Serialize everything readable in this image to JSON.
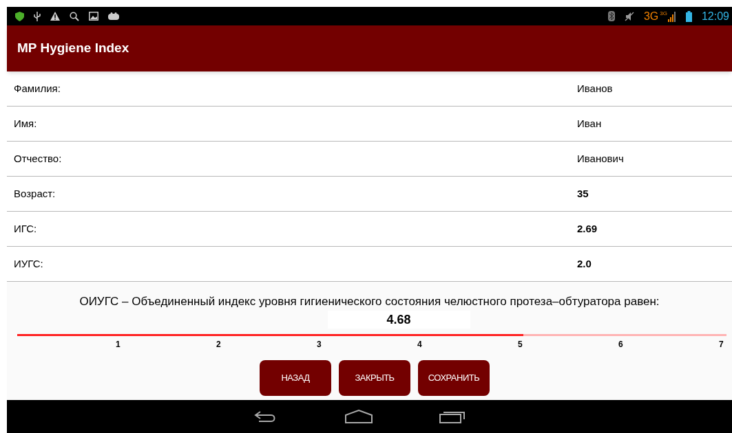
{
  "status_bar": {
    "network": "3G",
    "network_small": "3G",
    "time": "12:09"
  },
  "app_bar": {
    "title": "MP Hygiene Index"
  },
  "rows": [
    {
      "label": "Фамилия:",
      "value": "Иванов",
      "bold": false
    },
    {
      "label": "Имя:",
      "value": "Иван",
      "bold": false
    },
    {
      "label": "Отчество:",
      "value": "Иванович",
      "bold": false
    },
    {
      "label": "Возраст:",
      "value": "35",
      "bold": true
    },
    {
      "label": "ИГС:",
      "value": "2.69",
      "bold": true
    },
    {
      "label": "ИУГС:",
      "value": "2.0",
      "bold": true
    }
  ],
  "result": {
    "caption": "ОИУГС – Объединенный индекс уровня гигиенического состояния челюстного протеза–обтуратора равен:",
    "value": "4.68"
  },
  "scale": {
    "level": 0.714,
    "ticks": [
      "1",
      "2",
      "3",
      "4",
      "5",
      "6",
      "7"
    ]
  },
  "buttons": [
    "НАЗАД",
    "ЗАКРЫТЬ",
    "СОХРАНИТЬ"
  ]
}
